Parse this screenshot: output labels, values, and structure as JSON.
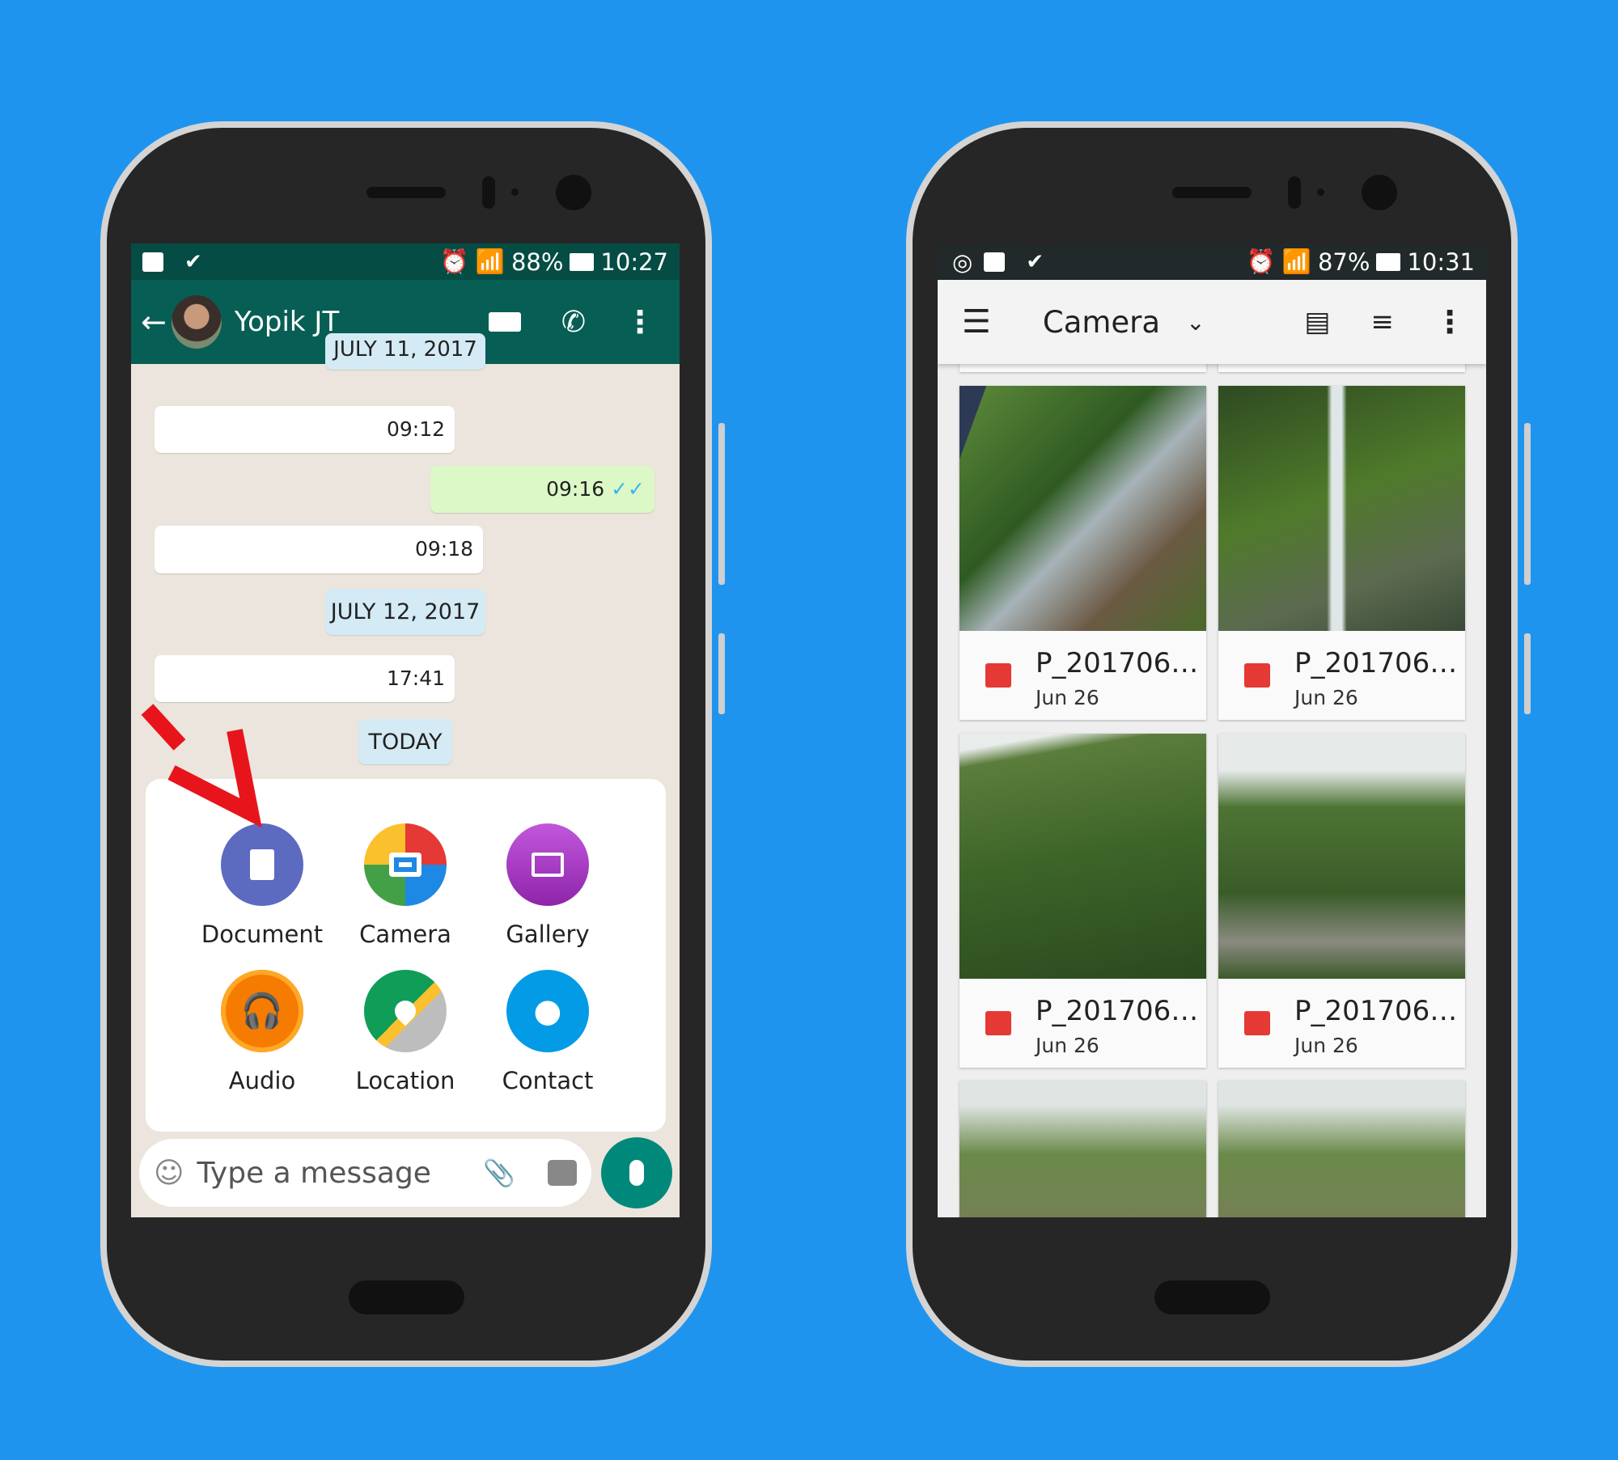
{
  "colors": {
    "background": "#1f94ef",
    "whatsapp_header": "#075e54",
    "whatsapp_status": "#054d44",
    "outgoing_bubble": "#dcf8c6",
    "annotation_arrow": "#e8141c"
  },
  "left_phone": {
    "status_bar": {
      "battery": "88%",
      "time": "10:27",
      "icons": [
        "image-icon",
        "check-icon",
        "alarm-icon",
        "wifi-icon",
        "signal-icon",
        "battery-icon"
      ]
    },
    "header": {
      "contact_name": "Yopik JT",
      "icons": [
        "back-arrow-icon",
        "avatar",
        "video-call-icon",
        "phone-icon",
        "more-vert-icon"
      ]
    },
    "messages": [
      {
        "type": "date",
        "text": "JULY 11, 2017"
      },
      {
        "type": "incoming",
        "time": "09:12"
      },
      {
        "type": "outgoing",
        "time": "09:16",
        "status": "✓✓"
      },
      {
        "type": "incoming",
        "time": "09:18"
      },
      {
        "type": "date",
        "text": "JULY 12, 2017"
      },
      {
        "type": "incoming",
        "time": "17:41"
      },
      {
        "type": "date",
        "text": "TODAY"
      }
    ],
    "attach_menu": [
      {
        "label": "Document",
        "color": "#5c6bc0",
        "icon": "document-icon"
      },
      {
        "label": "Camera",
        "color": "#ef6c00",
        "icon": "camera-icon"
      },
      {
        "label": "Gallery",
        "color": "#ab47bc",
        "icon": "gallery-icon"
      },
      {
        "label": "Audio",
        "color": "#f57c00",
        "icon": "headphones-icon"
      },
      {
        "label": "Location",
        "color": "#0f9d58",
        "icon": "location-pin-icon"
      },
      {
        "label": "Contact",
        "color": "#039be5",
        "icon": "person-icon"
      }
    ],
    "input": {
      "placeholder": "Type a message"
    }
  },
  "right_phone": {
    "status_bar": {
      "battery": "87%",
      "time": "10:31"
    },
    "toolbar": {
      "title": "Camera"
    },
    "photos": [
      {
        "title": "P_201706…",
        "date": "Jun 26"
      },
      {
        "title": "P_201706…",
        "date": "Jun 26"
      },
      {
        "title": "P_201706…",
        "date": "Jun 26"
      },
      {
        "title": "P_201706…",
        "date": "Jun 26"
      }
    ]
  }
}
